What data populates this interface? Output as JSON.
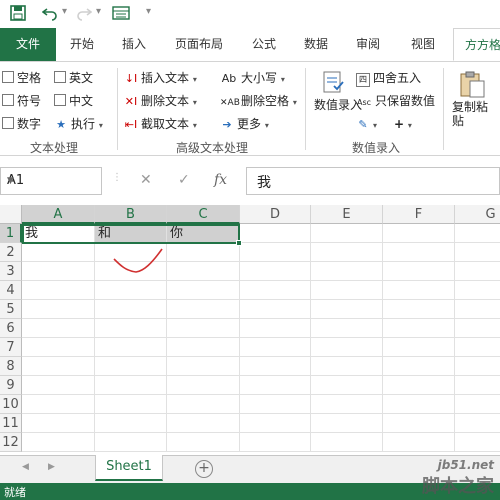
{
  "qat": {
    "save": "save-icon",
    "undo": "undo-icon",
    "redo": "redo-icon",
    "form": "form-icon",
    "customize": "customize-icon"
  },
  "tabs": [
    "文件",
    "开始",
    "插入",
    "页面布局",
    "公式",
    "数据",
    "审阅",
    "视图",
    "方方格"
  ],
  "ribbon": {
    "text_group": {
      "items": [
        "空格",
        "英文",
        "符号",
        "中文",
        "数字",
        "执行"
      ],
      "name": "文本处理"
    },
    "adv_group": {
      "items": [
        "插入文本",
        "大小写",
        "删除文本",
        "删除空格",
        "截取文本",
        "更多"
      ],
      "name": "高级文本处理"
    },
    "entry_group": {
      "big": "数值录入",
      "items": [
        "四舍五入",
        "只保留数值"
      ],
      "name": "数值录入"
    },
    "paste": "复制粘贴"
  },
  "formula_bar": {
    "name_box": "A1",
    "fx": "fx",
    "value": "我"
  },
  "columns": [
    "A",
    "B",
    "C",
    "D",
    "E",
    "F",
    "G"
  ],
  "rows": [
    "1",
    "2",
    "3",
    "4",
    "5",
    "6",
    "7",
    "8",
    "9",
    "10",
    "11",
    "12"
  ],
  "cells": {
    "A1": "我",
    "B1": "和",
    "C1": "你"
  },
  "sheets": [
    "Sheet1"
  ],
  "status": "就绪",
  "watermark": {
    "line1": "jb51.net",
    "line2": "脚本之家"
  },
  "colors": {
    "accent": "#217346",
    "annotation": "#d03030"
  }
}
